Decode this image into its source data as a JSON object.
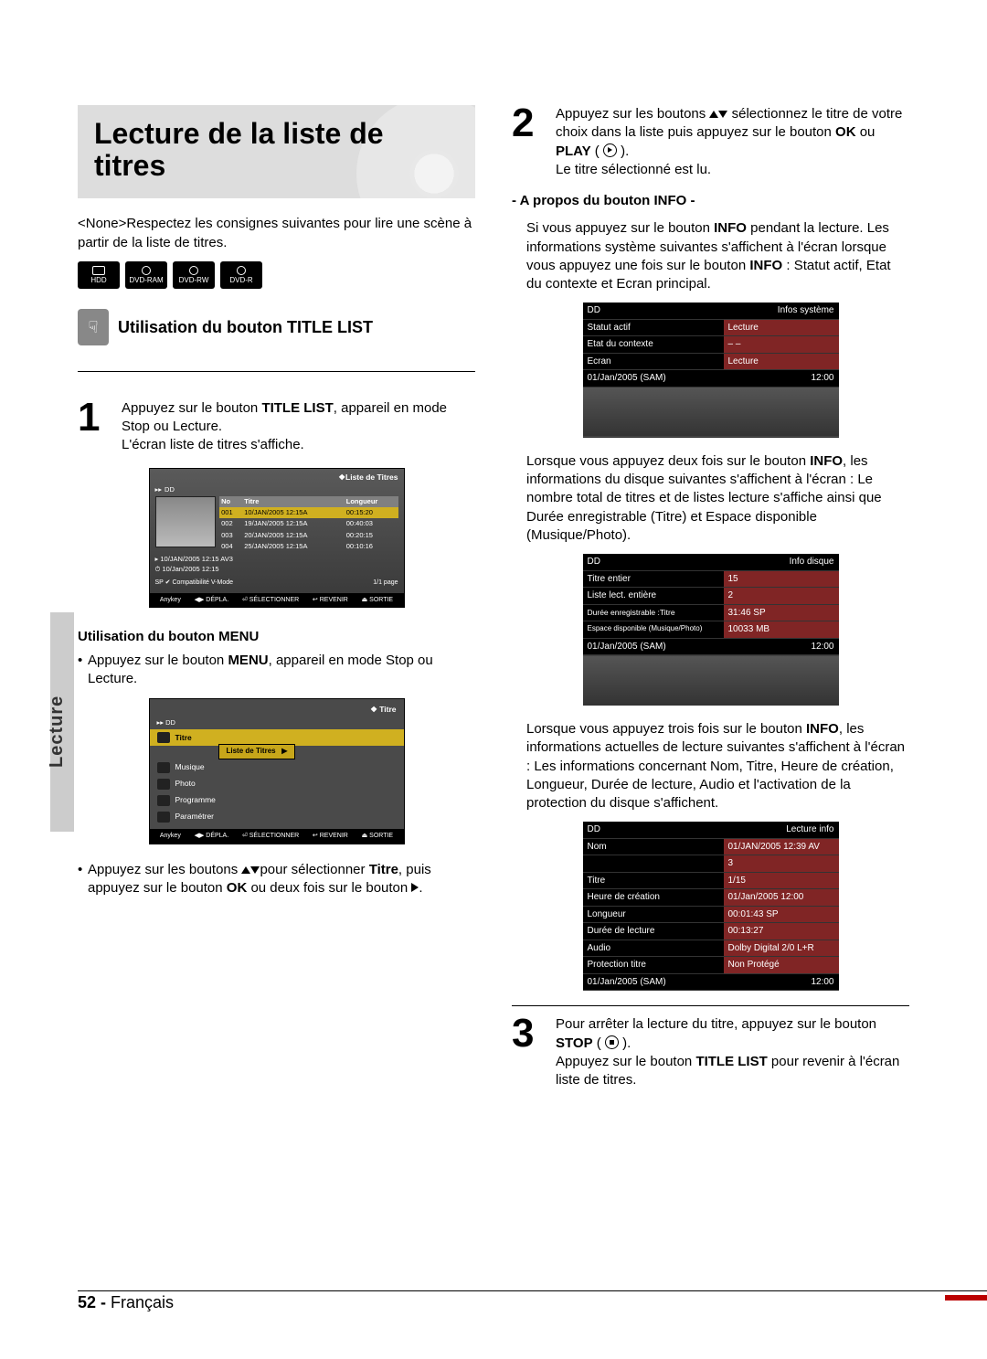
{
  "sideTab": "Lecture",
  "hero": {
    "title": "Lecture de la liste de titres"
  },
  "intro": "<None>Respectez les consignes suivantes pour lire une scène à partir de la liste de titres.",
  "mediaIcons": [
    "HDD",
    "DVD-RAM",
    "DVD-RW",
    "DVD-R"
  ],
  "section": {
    "badgeGlyph": "☟",
    "title": "Utilisation du bouton TITLE LIST"
  },
  "step1": {
    "num": "1",
    "text_a": "Appuyez sur le bouton ",
    "b1": "TITLE LIST",
    "text_b": ", appareil en mode Stop ou Lecture.",
    "text_c": "L'écran liste de titres s'affiche."
  },
  "osd1": {
    "title": "Liste de Titres",
    "hdd": "DD",
    "cols": [
      "No",
      "Titre",
      "Longueur"
    ],
    "rows": [
      [
        "001",
        "10/JAN/2005 12:15A",
        "00:15:20"
      ],
      [
        "002",
        "19/JAN/2005 12:15A",
        "00:40:03"
      ],
      [
        "003",
        "20/JAN/2005 12:15A",
        "00:20:15"
      ],
      [
        "004",
        "25/JAN/2005 12:15A",
        "00:10:16"
      ]
    ],
    "meta1": "10/JAN/2005 12:15 AV3",
    "meta2": "10/Jan/2005 12:15",
    "meta3_left": "SP ✔ Compatibilité V-Mode",
    "meta3_right": "1/1 page",
    "foot": [
      "Anykey",
      "◀▶ DÉPLA.",
      "⏎ SÉLECTIONNER",
      "↩ REVENIR",
      "⏏ SORTIE"
    ]
  },
  "menuUse": {
    "hdr": "Utilisation du bouton MENU",
    "bullet1_a": "Appuyez sur le bouton ",
    "bullet1_b": "MENU",
    "bullet1_c": ", appareil en mode Stop ou Lecture."
  },
  "osd2": {
    "title": "Titre",
    "hdd": "DD",
    "items": [
      "Titre",
      "Musique",
      "Photo",
      "Programme",
      "Paramétrer"
    ],
    "sub": "Liste de Titres",
    "foot": [
      "Anykey",
      "◀▶ DÉPLA.",
      "⏎ SÉLECTIONNER",
      "↩ REVENIR",
      "⏏ SORTIE"
    ]
  },
  "bullet2": {
    "a": "Appuyez sur les boutons ",
    "b": "pour sélectionner ",
    "c": "Titre",
    "d": ", puis appuyez sur le bouton ",
    "e": "OK",
    "f": " ou deux fois sur le bouton ",
    "g": "."
  },
  "step2": {
    "num": "2",
    "a": "Appuyez sur les boutons ",
    "b": " sélectionnez le titre de votre choix dans la liste puis appuyez sur le bouton ",
    "c": "OK",
    "d": " ou ",
    "e": "PLAY",
    "f": " ( ",
    "g": " ).",
    "h": "Le titre sélectionné est lu."
  },
  "infoHdr": "- A propos du bouton INFO -",
  "infoP1_a": "Si vous appuyez sur le bouton ",
  "infoP1_b": "INFO",
  "infoP1_c": " pendant la lecture. Les informations système suivantes s'affichent à l'écran lorsque vous appuyez une fois sur le bouton ",
  "infoP1_d": "INFO",
  "infoP1_e": " : Statut actif, Etat du contexte et Ecran principal.",
  "table1": {
    "hdrL": "DD",
    "hdrR": "Infos système",
    "rows": [
      [
        "Statut actif",
        "Lecture"
      ],
      [
        "Etat du contexte",
        "– –"
      ],
      [
        "Ecran",
        "Lecture"
      ]
    ],
    "footL": "01/Jan/2005 (SAM)",
    "footR": "12:00"
  },
  "infoP2_a": "Lorsque vous appuyez deux fois sur le bouton ",
  "infoP2_b": "INFO",
  "infoP2_c": ", les informations du disque suivantes s'affichent à l'écran : Le nombre total de titres et de listes lecture s'affiche ainsi que Durée enregistrable (Titre) et Espace disponible (Musique/Photo).",
  "table2": {
    "hdrL": "DD",
    "hdrR": "Info disque",
    "rows": [
      [
        "Titre entier",
        "15"
      ],
      [
        "Liste lect. entière",
        "2"
      ],
      [
        "Durée enregistrable :Titre",
        "31:46  SP"
      ],
      [
        "Espace disponible (Musique/Photo)",
        "10033 MB"
      ]
    ],
    "footL": "01/Jan/2005 (SAM)",
    "footR": "12:00"
  },
  "infoP3_a": "Lorsque vous appuyez trois fois sur le bouton ",
  "infoP3_b": "INFO",
  "infoP3_c": ", les informations actuelles de lecture suivantes s'affichent à l'écran : Les informations concernant Nom, Titre, Heure de création, Longueur, Durée de lecture, Audio et l'activation de la protection du disque s'affichent.",
  "table3": {
    "hdrL": "DD",
    "hdrR": "Lecture info",
    "rows": [
      [
        "Nom",
        "01/JAN/2005 12:39 AV"
      ],
      [
        "",
        "3"
      ],
      [
        "Titre",
        "1/15"
      ],
      [
        "Heure de création",
        "01/Jan/2005 12:00"
      ],
      [
        "Longueur",
        "00:01:43 SP"
      ],
      [
        "Durée de lecture",
        "00:13:27"
      ],
      [
        "Audio",
        "Dolby Digital 2/0 L+R"
      ],
      [
        "Protection titre",
        "Non Protégé"
      ]
    ],
    "footL": "01/Jan/2005 (SAM)",
    "footR": "12:00"
  },
  "step3": {
    "num": "3",
    "a": "Pour arrêter la lecture du titre, appuyez sur le bouton ",
    "b": "STOP",
    "c": " ( ",
    "d": " ).",
    "e": "Appuyez sur le bouton ",
    "f": "TITLE LIST",
    "g": " pour revenir à l'écran liste de titres."
  },
  "footer": {
    "page": "52 - ",
    "lang": "Français"
  }
}
